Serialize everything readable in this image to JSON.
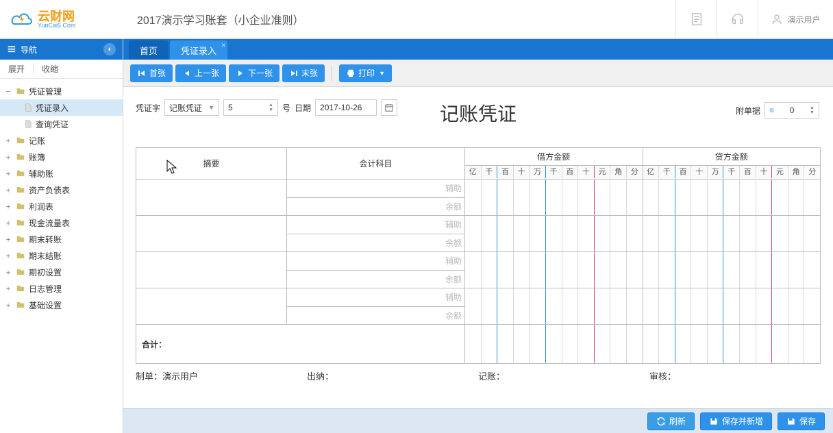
{
  "header": {
    "logo_cn": "云财网",
    "logo_en": "YunCai5.Com",
    "company": "2017演示学习账套（小企业准则）",
    "user": "演示用户"
  },
  "sidebar": {
    "title": "导航",
    "expand": "展开",
    "collapse": "收缩",
    "items": [
      {
        "label": "凭证管理",
        "expanded": true,
        "children": [
          {
            "label": "凭证录入",
            "active": true
          },
          {
            "label": "查询凭证"
          }
        ]
      },
      {
        "label": "记账"
      },
      {
        "label": "账簿"
      },
      {
        "label": "辅助账"
      },
      {
        "label": "资产负债表"
      },
      {
        "label": "利润表"
      },
      {
        "label": "现金流量表"
      },
      {
        "label": "期末转账"
      },
      {
        "label": "期末结账"
      },
      {
        "label": "期初设置"
      },
      {
        "label": "日志管理"
      },
      {
        "label": "基础设置"
      }
    ]
  },
  "tabs": [
    {
      "label": "首页",
      "active": false
    },
    {
      "label": "凭证录入",
      "active": true,
      "closable": true
    }
  ],
  "toolbar": {
    "first": "首张",
    "prev": "上一张",
    "next": "下一张",
    "last": "末张",
    "print": "打印"
  },
  "voucher": {
    "word_label": "凭证字",
    "word_value": "记账凭证",
    "number": "5",
    "number_suffix": "号",
    "date_label": "日期",
    "date_value": "2017-10-26",
    "title": "记账凭证",
    "attach_label": "附单据",
    "attach_value": "0",
    "cols": {
      "summary": "摘要",
      "subject": "会计科目",
      "debit": "借方金额",
      "credit": "贷方金额"
    },
    "digits": [
      "亿",
      "千",
      "百",
      "十",
      "万",
      "千",
      "百",
      "十",
      "元",
      "角",
      "分"
    ],
    "row_hints": {
      "assist": "辅助",
      "balance": "余额"
    },
    "total": "合计：",
    "footer": {
      "maker_label": "制单：",
      "maker_value": "演示用户",
      "cashier_label": "出纳：",
      "poster_label": "记账：",
      "auditor_label": "审核："
    }
  },
  "actions": {
    "refresh": "刷新",
    "save_new": "保存并新增",
    "save": "保存"
  }
}
